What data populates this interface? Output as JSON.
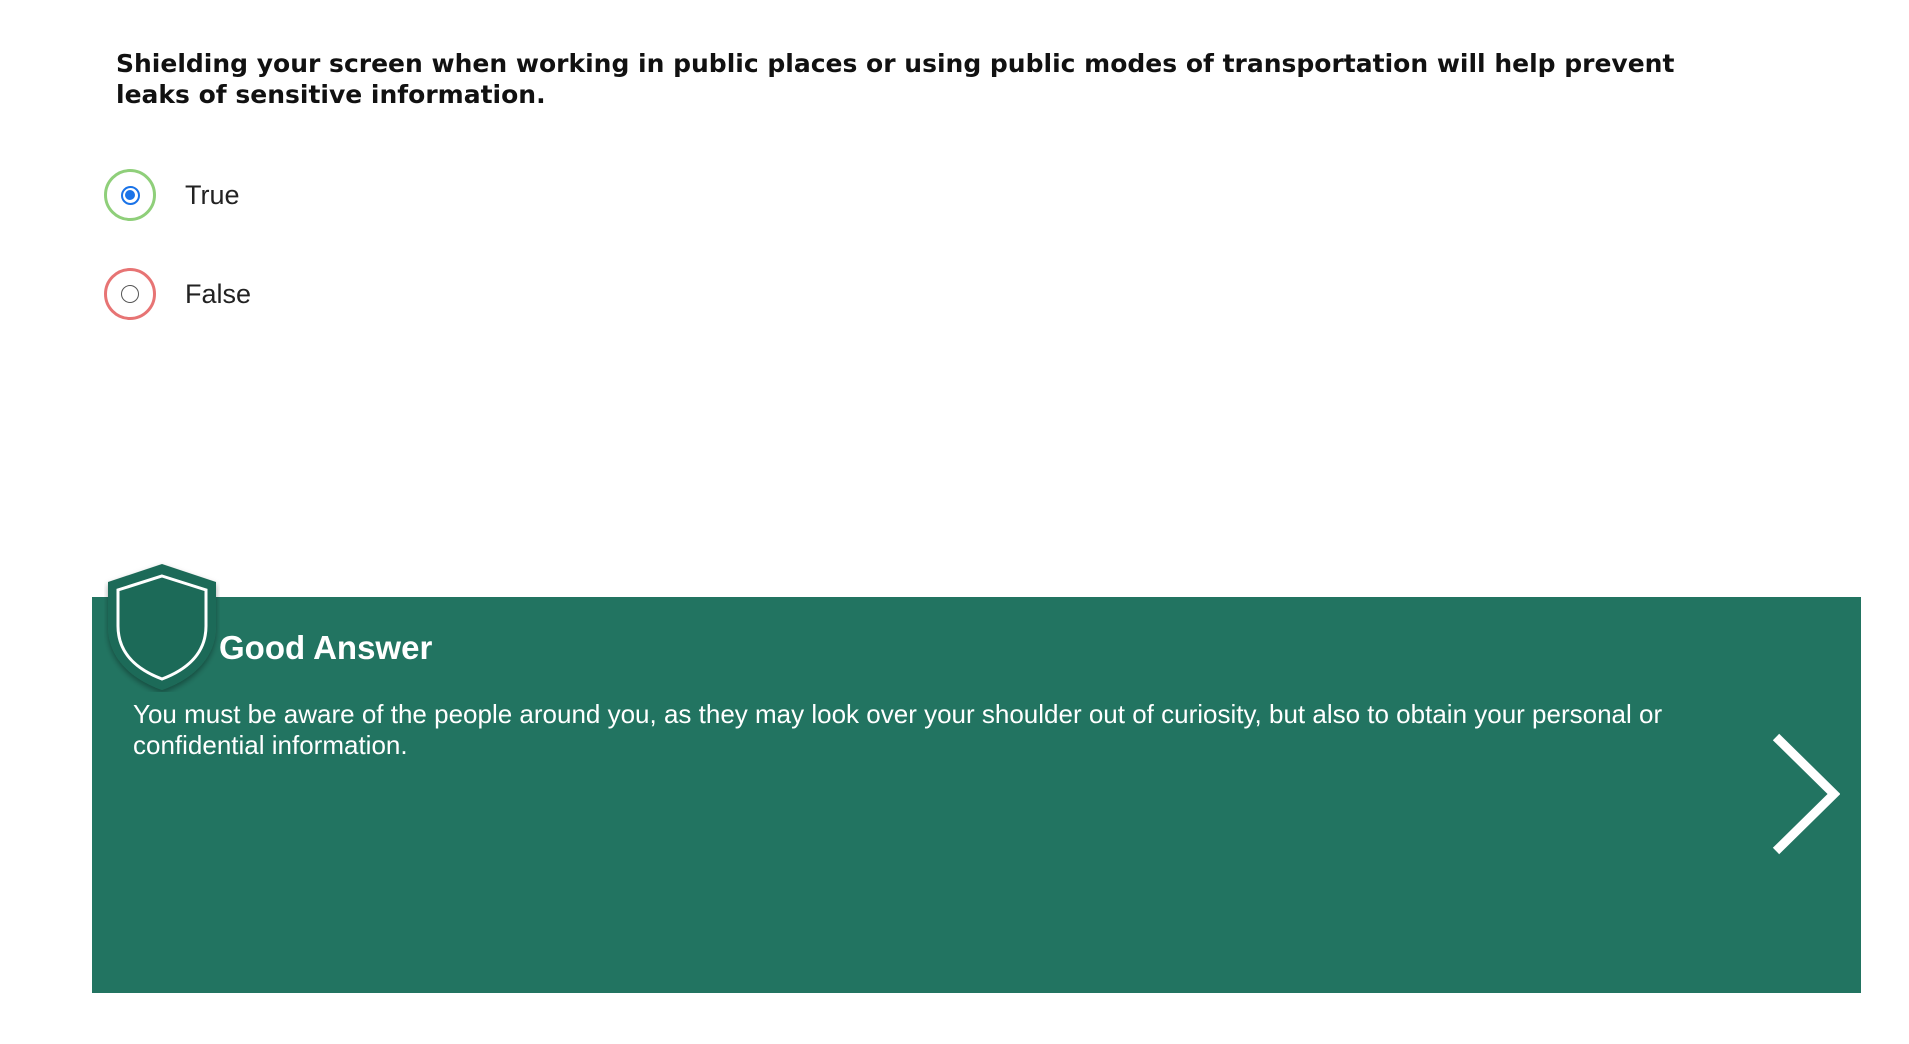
{
  "question": {
    "text": "Shielding your screen when working in public places or using public modes of transportation will help prevent leaks of sensitive information."
  },
  "options": [
    {
      "label": "True",
      "selected": true,
      "ring_color": "#8fcf7a"
    },
    {
      "label": "False",
      "selected": false,
      "ring_color": "#e77474"
    }
  ],
  "feedback": {
    "icon": "shield-icon",
    "title": "Good Answer",
    "text": "You must be aware of the people around you, as they may look over your shoulder out of curiosity, but also to obtain your personal or confidential information.",
    "background_color": "#227461",
    "next_icon": "chevron-right-icon"
  }
}
